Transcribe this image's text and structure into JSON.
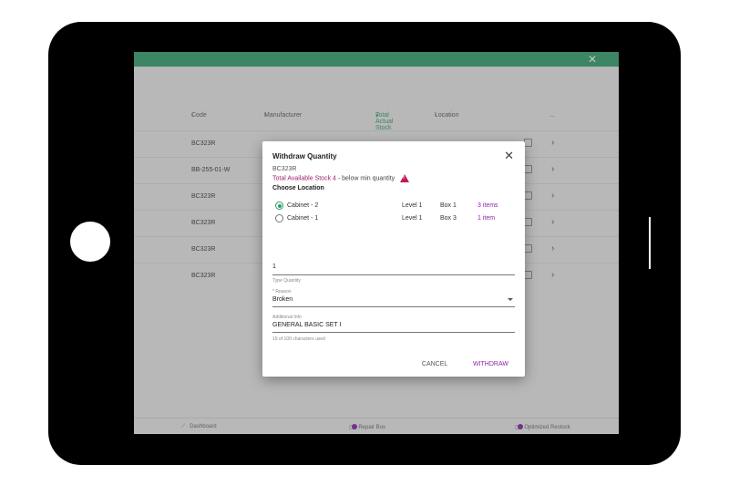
{
  "app": {
    "close_icon": "close-icon"
  },
  "table": {
    "headers": {
      "code": "Code",
      "manufacturer": "Manufacturer",
      "total_actual_stock": "Total Actual Stock",
      "location": "Location",
      "more": "..."
    },
    "rows": [
      {
        "code": "BC323R"
      },
      {
        "code": "BB-255-01-W"
      },
      {
        "code": "BC323R"
      },
      {
        "code": "BC323R"
      },
      {
        "code": "BC323R"
      },
      {
        "code": "BC323R"
      }
    ]
  },
  "bottom_nav": {
    "dashboard": "Dashboard",
    "repair_box": "Repair Box",
    "optimized_restock": "Optimized Restock"
  },
  "dialog": {
    "title": "Withdraw Quantity",
    "code": "BC323R",
    "stock_label": "Total Available Stock 4",
    "stock_note": " - below min quantity",
    "warn_glyph": "!",
    "choose_location": "Choose Location",
    "locations": [
      {
        "name": "Cabinet - 2",
        "level": "Level 1",
        "box": "Box 1",
        "items": "3 items",
        "selected": true
      },
      {
        "name": "Cabinet - 1",
        "level": "Level 1",
        "box": "Box 3",
        "items": "1 item",
        "selected": false
      }
    ],
    "quantity_value": "1",
    "quantity_helper": "Type Quantity",
    "reason_label": "* Reason",
    "reason_value": "Broken",
    "additional_label": "Additional Info",
    "additional_value": "GENERAL BASIC SET I",
    "char_counter": "19 of 100 characters used",
    "cancel": "CANCEL",
    "withdraw": "WITHDRAW"
  },
  "colors": {
    "accent_green": "#2e9e6a",
    "accent_purple": "#8e24aa",
    "warning": "#c2185b"
  }
}
